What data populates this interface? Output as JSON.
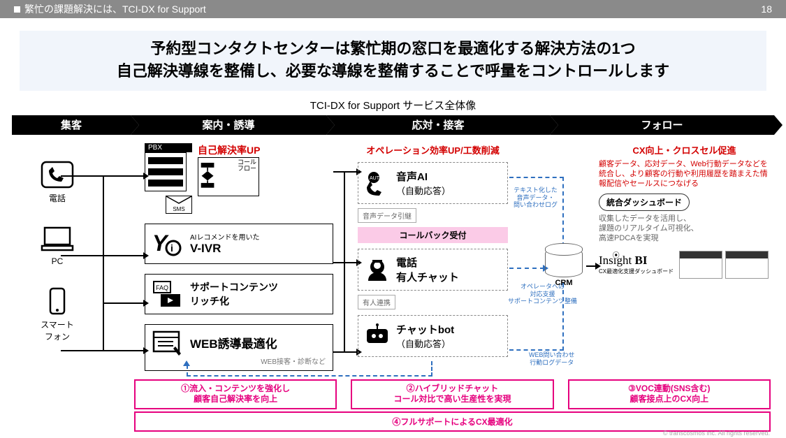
{
  "topbar": {
    "title": "繁忙の課題解決には、TCI-DX for Support",
    "page": "18"
  },
  "headline": {
    "l1": "予約型コンタクトセンターは繁忙期の窓口を最適化する解決方法の1つ",
    "l2": "自己解決導線を整備し、必要な導線を整備することで呼量をコントロールします"
  },
  "subtitle": "TCI-DX for Support サービス全体像",
  "steps": {
    "s1": "集客",
    "s2": "案内・誘導",
    "s3": "応対・接客",
    "s4": "フォロー"
  },
  "devices": {
    "tel": "電話",
    "pc": "PC",
    "phone": "スマート\nフォン"
  },
  "guide": {
    "pbx": "PBX",
    "callflow1": "コール",
    "callflow2": "フロー",
    "sms": "SMS",
    "red": "自己解決率UP",
    "vivr_sub": "AIレコメンドを用いた",
    "vivr": "V-IVR",
    "faq": "FAQ",
    "sup": "サポートコンテンツ\nリッチ化",
    "web": "WEB誘導最適化",
    "websub": "WEB接客・診断など"
  },
  "resp": {
    "red": "オペレーション効率UP/工数削減",
    "ai1": "音声AI",
    "ai2": "（自動応答）",
    "tag1": "音声データ引継",
    "callback": "コールバック受付",
    "tel1": "電話",
    "tel2": "有人チャット",
    "tag2": "有人連携",
    "bot1": "チャットbot",
    "bot2": "（自動応答）"
  },
  "bnotes": {
    "n1": "テキスト化した\n音声データ・\n問い合わせログ",
    "n2": "オペレータへの\n対応支援\nサポートコンテンツ整備",
    "n3": "WEB問い合わせ\n行動ログデータ"
  },
  "crm": "CRM",
  "right": {
    "red": "CX向上・クロスセル促進",
    "desc": "顧客データ、応対データ、Web行動データなどを統合し、より顧客の行動や利用履歴を踏まえた情報配信やセールスにつなげる",
    "pill": "統合ダッシュボード",
    "grey": "収集したデータを活用し、\n課題のリアルタイム可視化、\n高速PDCAを実現",
    "insight": "Insight BI",
    "insightsub": "CX最適化支援ダッシュボード"
  },
  "pink": {
    "p1a": "①流入・コンテンツを強化し",
    "p1b": "顧客自己解決率を向上",
    "p2a": "②ハイブリッドチャット",
    "p2b": "コール対比で高い生産性を実現",
    "p3a": "③VOC連動(SNS含む)",
    "p3b": "顧客接点上のCX向上",
    "p4": "④フルサポートによるCX最適化"
  },
  "footer": "© transcosmos inc. All rights reserved."
}
